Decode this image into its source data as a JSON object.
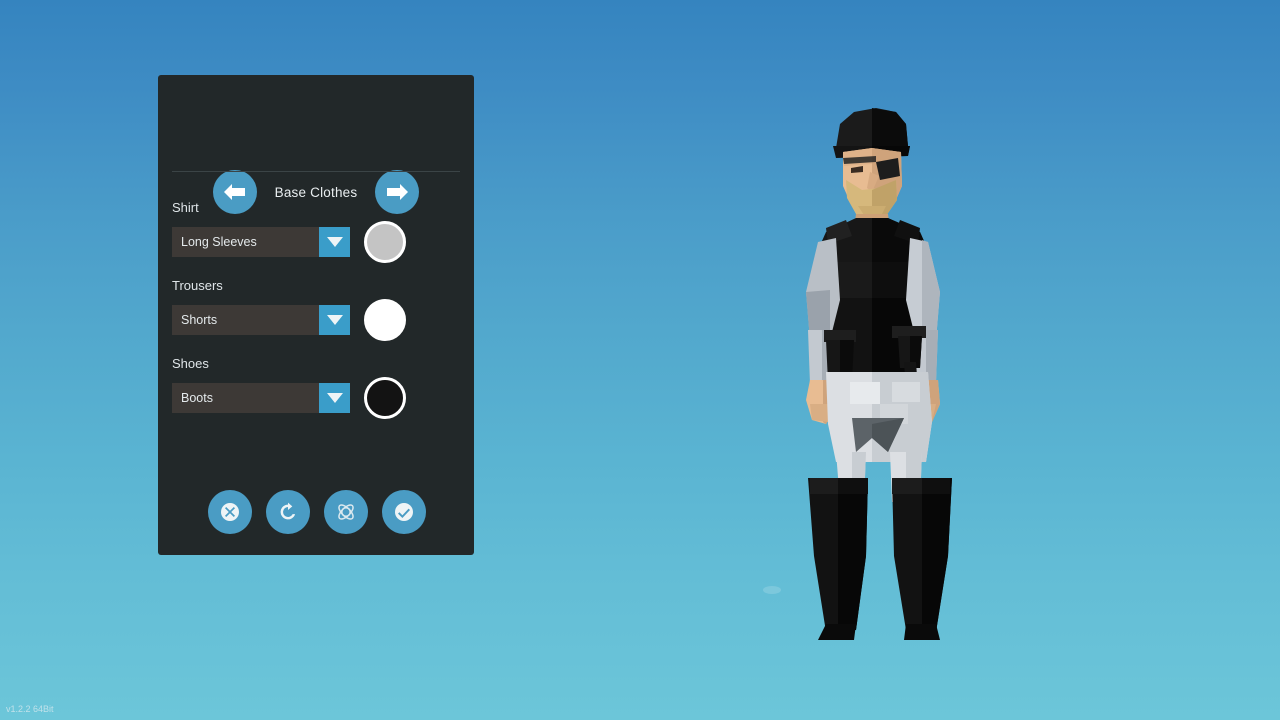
{
  "app": {
    "version_label": "v1.2.2 64Bit",
    "background_top_color": "#3584bf",
    "background_bottom_color": "#6cc6d9",
    "accent_color": "#4a9cc4",
    "panel_color": "#222829"
  },
  "panel": {
    "category_title": "Base Clothes",
    "prev_label": "Previous category",
    "next_label": "Next category",
    "options": [
      {
        "label": "Shirt",
        "value": "Long Sleeves",
        "color": "#c4c4c4",
        "name": "shirt"
      },
      {
        "label": "Trousers",
        "value": "Shorts",
        "color": "#ffffff",
        "name": "trousers"
      },
      {
        "label": "Shoes",
        "value": "Boots",
        "color": "#131313",
        "name": "shoes"
      }
    ],
    "actions": [
      {
        "name": "cancel",
        "icon": "cancel-icon",
        "label": "Cancel"
      },
      {
        "name": "reset",
        "icon": "reset-icon",
        "label": "Reset"
      },
      {
        "name": "randomize",
        "icon": "randomize-icon",
        "label": "Randomize"
      },
      {
        "name": "confirm",
        "icon": "confirm-icon",
        "label": "Confirm"
      }
    ]
  },
  "character": {
    "description": "Low-poly male character in black tactical vest, grey long sleeves, white shorts and tall black boots",
    "hat_color": "#141414",
    "vest_color": "#0e0e0e",
    "sleeve_color": "#b9bfc6",
    "skin_color": "#e8bc92",
    "beard_color": "#d6b87c",
    "shorts_color": "#dcdfe3",
    "boots_color": "#0d0d0d",
    "eyepatch_color": "#1a1a1a"
  }
}
